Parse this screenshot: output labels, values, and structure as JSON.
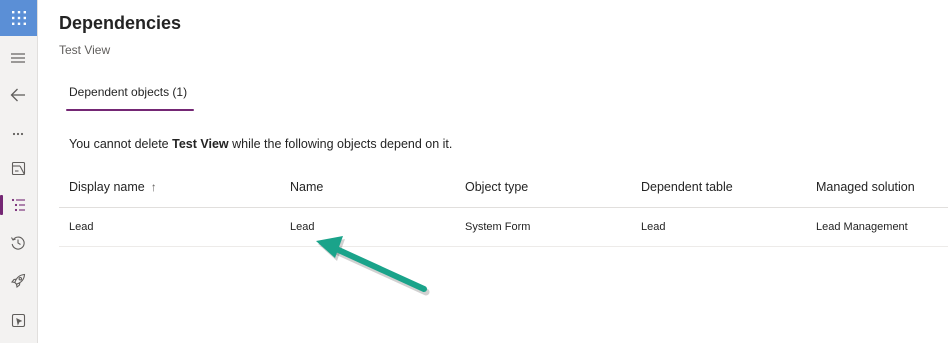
{
  "nav_rail": {
    "items": [
      {
        "icon": "app-launcher-icon"
      },
      {
        "icon": "menu-icon"
      },
      {
        "icon": "back-arrow-icon"
      },
      {
        "icon": "more-icon"
      },
      {
        "icon": "objects-icon"
      },
      {
        "icon": "dependencies-icon",
        "active": true
      },
      {
        "icon": "history-icon"
      },
      {
        "icon": "rocket-icon"
      },
      {
        "icon": "solution-checker-icon"
      }
    ],
    "active_color": "#742774",
    "launcher_color": "#5b8fd6"
  },
  "header": {
    "title": "Dependencies",
    "subtitle": "Test View"
  },
  "tabs": [
    {
      "label": "Dependent objects (1)",
      "selected": true
    }
  ],
  "message": {
    "prefix": "You cannot delete ",
    "object_name": "Test View",
    "suffix": " while the following objects depend on it."
  },
  "table": {
    "columns": [
      {
        "label": "Display name",
        "sorted": "ascending",
        "sort_icon": "↑"
      },
      {
        "label": "Name"
      },
      {
        "label": "Object type"
      },
      {
        "label": "Dependent table"
      },
      {
        "label": "Managed solution"
      }
    ],
    "rows": [
      [
        "Lead",
        "Lead",
        "System Form",
        "Lead",
        "Lead Management"
      ]
    ]
  },
  "annotation": {
    "type": "arrow",
    "color": "#1aa38a",
    "points_to": "rows.0.name"
  }
}
